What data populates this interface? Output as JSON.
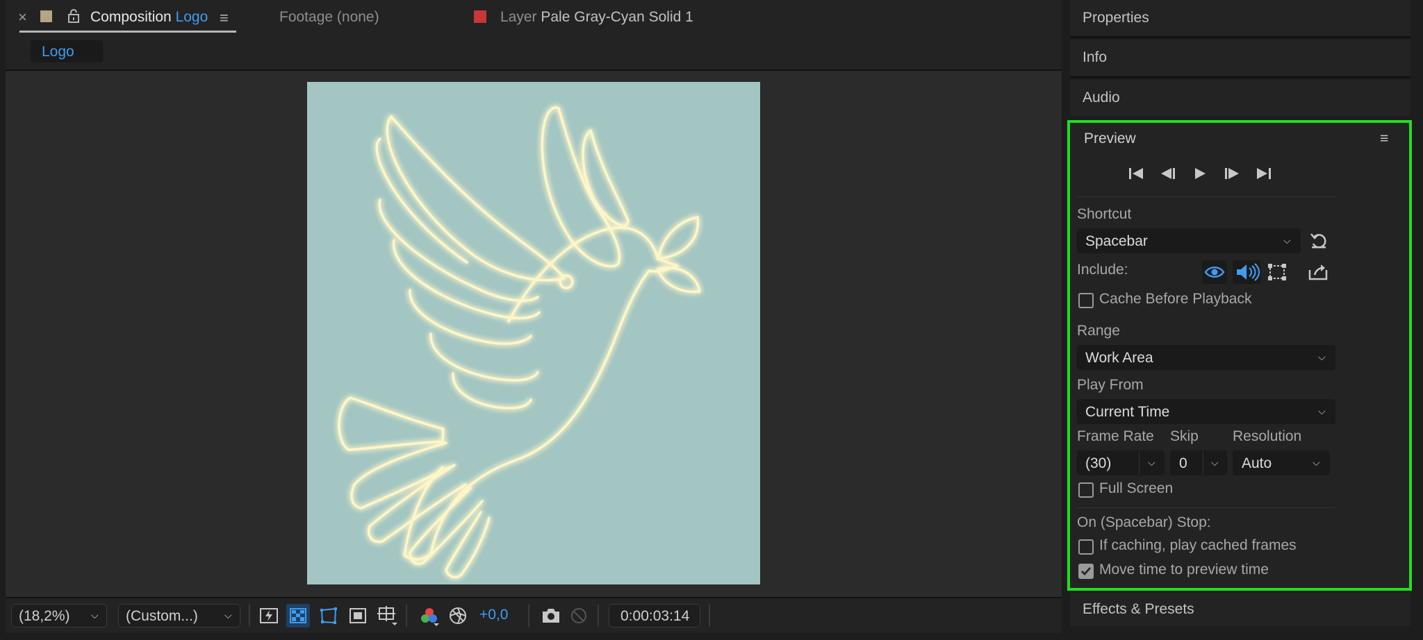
{
  "composition_tab": {
    "close_glyph": "×",
    "label_prefix": "Composition",
    "name": "Logo",
    "menu_glyph": "≡"
  },
  "footage_tab": {
    "label": "Footage (none)"
  },
  "layer_tab": {
    "label_prefix": "Layer",
    "name": "Pale Gray-Cyan Solid 1",
    "swatch_color": "#c8363a"
  },
  "breadcrumb": {
    "label": "Logo"
  },
  "canvas": {
    "background_color": "#a3c6c3",
    "artwork_stroke_color": "#fff6c8"
  },
  "bottom_bar": {
    "zoom_value": "(18,2%)",
    "resolution_value": "(Custom...)",
    "exposure_value": "+0,0",
    "timecode": "0:00:03:14"
  },
  "panels": {
    "properties": "Properties",
    "info": "Info",
    "audio": "Audio",
    "effects_presets": "Effects & Presets"
  },
  "preview": {
    "title": "Preview",
    "menu_glyph": "≡",
    "shortcut_label": "Shortcut",
    "shortcut_value": "Spacebar",
    "include_label": "Include:",
    "cache_before_playback": "Cache Before Playback",
    "range_label": "Range",
    "range_value": "Work Area",
    "play_from_label": "Play From",
    "play_from_value": "Current Time",
    "frame_rate_label": "Frame Rate",
    "frame_rate_value": "(30)",
    "skip_label": "Skip",
    "skip_value": "0",
    "resolution_label": "Resolution",
    "resolution_value": "Auto",
    "full_screen": "Full Screen",
    "on_stop_label": "On (Spacebar) Stop:",
    "if_caching": "If caching, play cached frames",
    "move_time": "Move time to preview time",
    "cache_before_playback_checked": false,
    "full_screen_checked": false,
    "if_caching_checked": false,
    "move_time_checked": true,
    "accent_color": "#2d8ceb",
    "highlight_border_color": "#1ee11e"
  }
}
